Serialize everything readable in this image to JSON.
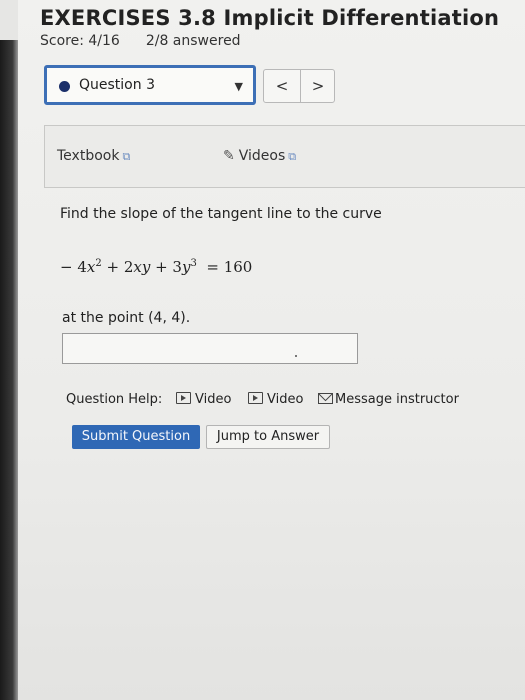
{
  "header": {
    "title": "EXERCISES 3.8 Implicit Differentiation",
    "score": "Score: 4/16",
    "answered": "2/8 answered"
  },
  "question_nav": {
    "selected": "Question 3",
    "prev_label": "<",
    "next_label": ">"
  },
  "resources": {
    "textbook": "Textbook",
    "videos": "Videos"
  },
  "problem": {
    "prompt": "Find the slope of the tangent line to the curve",
    "point_text": "at the point (4, 4).",
    "answer_value": ""
  },
  "help": {
    "label": "Question Help:",
    "video1": "Video",
    "video2": "Video",
    "message": "Message instructor"
  },
  "actions": {
    "submit": "Submit Question",
    "jump": "Jump to Answer"
  },
  "colors": {
    "accent": "#2f68b5",
    "focus_border": "#3d6fb6",
    "dot": "#1b2f6a"
  }
}
